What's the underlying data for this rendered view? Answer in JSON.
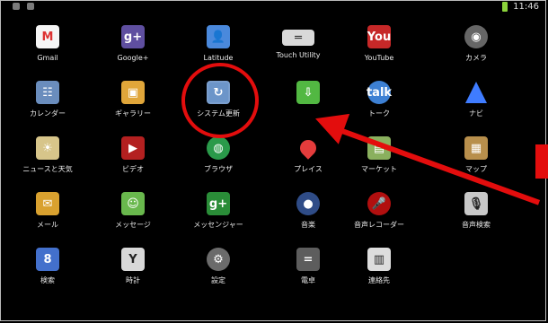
{
  "status": {
    "time": "11:46"
  },
  "apps": [
    {
      "label": "Gmail",
      "symbol": "M",
      "icon": "gmail-icon"
    },
    {
      "label": "Google+",
      "symbol": "g+",
      "icon": "google-plus-icon"
    },
    {
      "label": "Latitude",
      "symbol": "👤",
      "icon": "latitude-icon"
    },
    {
      "label": "Touch Utility",
      "symbol": "═",
      "icon": "touch-utility-icon"
    },
    {
      "label": "YouTube",
      "symbol": "You",
      "icon": "youtube-icon"
    },
    {
      "label": "カメラ",
      "symbol": "◉",
      "icon": "camera-icon"
    },
    {
      "label": "カレンダー",
      "symbol": "☷",
      "icon": "calendar-icon"
    },
    {
      "label": "ギャラリー",
      "symbol": "▣",
      "icon": "gallery-icon"
    },
    {
      "label": "システム更新",
      "symbol": "↻",
      "icon": "system-update-icon"
    },
    {
      "label": "",
      "symbol": "⇩",
      "icon": "download-icon"
    },
    {
      "label": "トーク",
      "symbol": "talk",
      "icon": "talk-icon"
    },
    {
      "label": "ナビ",
      "symbol": "",
      "icon": "navigation-icon"
    },
    {
      "label": "ニュースと天気",
      "symbol": "☀",
      "icon": "news-weather-icon"
    },
    {
      "label": "ビデオ",
      "symbol": "▶",
      "icon": "video-icon"
    },
    {
      "label": "ブラウザ",
      "symbol": "◍",
      "icon": "browser-icon"
    },
    {
      "label": "プレイス",
      "symbol": "",
      "icon": "places-icon"
    },
    {
      "label": "マーケット",
      "symbol": "▤",
      "icon": "market-icon"
    },
    {
      "label": "マップ",
      "symbol": "▦",
      "icon": "maps-icon"
    },
    {
      "label": "メール",
      "symbol": "✉",
      "icon": "email-icon"
    },
    {
      "label": "メッセージ",
      "symbol": "☺",
      "icon": "messages-icon"
    },
    {
      "label": "メッセンジャー",
      "symbol": "g+",
      "icon": "messenger-icon"
    },
    {
      "label": "音楽",
      "symbol": "●",
      "icon": "music-icon"
    },
    {
      "label": "音声レコーダー",
      "symbol": "🎤",
      "icon": "voice-recorder-icon"
    },
    {
      "label": "音声検索",
      "symbol": "🎙",
      "icon": "voice-search-icon"
    },
    {
      "label": "検索",
      "symbol": "8",
      "icon": "search-icon"
    },
    {
      "label": "時計",
      "symbol": "Y",
      "icon": "clock-icon"
    },
    {
      "label": "設定",
      "symbol": "⚙",
      "icon": "settings-icon"
    },
    {
      "label": "電卓",
      "symbol": "=",
      "icon": "calculator-icon"
    },
    {
      "label": "連絡先",
      "symbol": "▥",
      "icon": "contacts-icon"
    }
  ]
}
